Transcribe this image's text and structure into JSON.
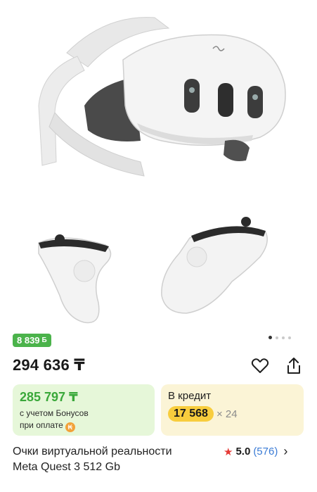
{
  "gallery": {
    "alt_product": "vr-headset-with-controllers",
    "dots_total": 4,
    "dots_active_index": 0
  },
  "badge": {
    "bonus_amount": "8 839",
    "bonus_icon": "Б"
  },
  "price": {
    "main": "294 636 ₸"
  },
  "actions": {
    "favorite_icon": "heart-outline-icon",
    "share_icon": "share-icon"
  },
  "bonus_card": {
    "price": "285 797 ₸",
    "line1": "с учетом Бонусов",
    "line2": "при оплате",
    "pay_icon": "₭"
  },
  "credit_card": {
    "title": "В кредит",
    "amount": "17 568",
    "months": "× 24"
  },
  "product": {
    "title_line1": "Очки виртуальной реальности",
    "title_line2": "Meta Quest 3 512 Gb"
  },
  "rating": {
    "score": "5.0",
    "count": "(576)"
  },
  "colors": {
    "bonus_green": "#4bb34b",
    "bonus_card_bg": "#e6f7d9",
    "credit_card_bg": "#fbf4d6",
    "credit_amount_bg": "#f8cd3d",
    "star_red": "#e53935",
    "link_blue": "#3a7bd5"
  }
}
